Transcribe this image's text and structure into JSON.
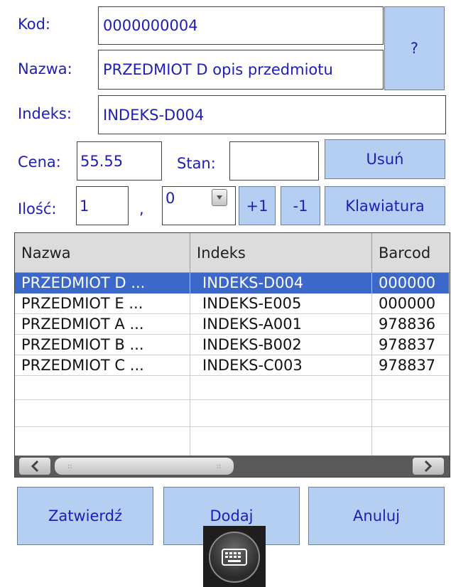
{
  "form": {
    "kod_label": "Kod:",
    "kod_value": "0000000004",
    "nazwa_label": "Nazwa:",
    "nazwa_value": "PRZEDMIOT D opis przedmiotu",
    "help_button": "?",
    "indeks_label": "Indeks:",
    "indeks_value": "INDEKS-D004",
    "cena_label": "Cena:",
    "cena_value": "55.55",
    "stan_label": "Stan:",
    "stan_value": "",
    "usun_button": "Usuń",
    "ilosc_label": "Ilość:",
    "ilosc_int": "1",
    "decimal_sep": ",",
    "ilosc_frac": "0",
    "plus_button": "+1",
    "minus_button": "-1",
    "keyboard_button": "Klawiatura"
  },
  "table": {
    "columns": [
      "Nazwa",
      "Indeks",
      "Barcod"
    ],
    "rows": [
      [
        "PRZEDMIOT D ...",
        "INDEKS-D004",
        "000000"
      ],
      [
        "PRZEDMIOT E ...",
        "INDEKS-E005",
        "000000"
      ],
      [
        "PRZEDMIOT A ...",
        "INDEKS-A001",
        "978836"
      ],
      [
        "PRZEDMIOT B ...",
        "INDEKS-B002",
        "978837"
      ],
      [
        "PRZEDMIOT C ...",
        "INDEKS-C003",
        "978837"
      ]
    ],
    "selected_row": 0
  },
  "footer": {
    "confirm_button": "Zatwierdź",
    "add_button": "Dodaj",
    "cancel_button": "Anuluj"
  },
  "icons": [
    "keyboard-icon",
    "scroll-left-icon",
    "scroll-right-icon",
    "spinner-down-icon"
  ],
  "colors": {
    "button_bg": "#b5cff2",
    "label_text": "#1e1eb4",
    "selection": "#3c69c9"
  }
}
